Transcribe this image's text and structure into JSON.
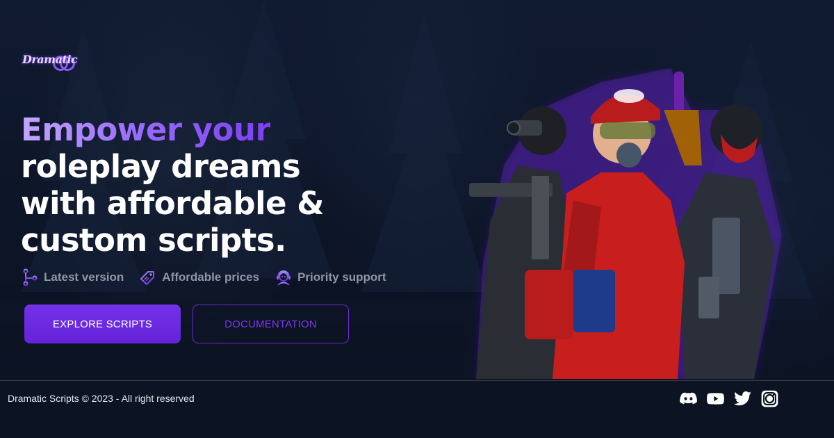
{
  "brand": {
    "logo_text": "Dramatic",
    "accent": "#7c3aed"
  },
  "hero": {
    "headline_accent": "Empower your",
    "headline_lines": [
      "roleplay dreams",
      "with affordable &",
      "custom scripts."
    ],
    "features": [
      {
        "icon": "git-branch-icon",
        "label": "Latest version"
      },
      {
        "icon": "price-tag-icon",
        "label": "Affordable prices"
      },
      {
        "icon": "support-agent-icon",
        "label": "Priority support"
      }
    ],
    "buttons": {
      "primary": "EXPLORE SCRIPTS",
      "secondary": "DOCUMENTATION"
    },
    "image": "three-masked-characters-illustration"
  },
  "footer": {
    "copyright": "Dramatic Scripts © 2023 - All right reserved",
    "socials": [
      "discord-icon",
      "youtube-icon",
      "twitter-icon",
      "instagram-icon"
    ]
  },
  "colors": {
    "background": "#0b1222",
    "primary_button": "#6d28d9",
    "muted_text": "#8f97a6"
  }
}
